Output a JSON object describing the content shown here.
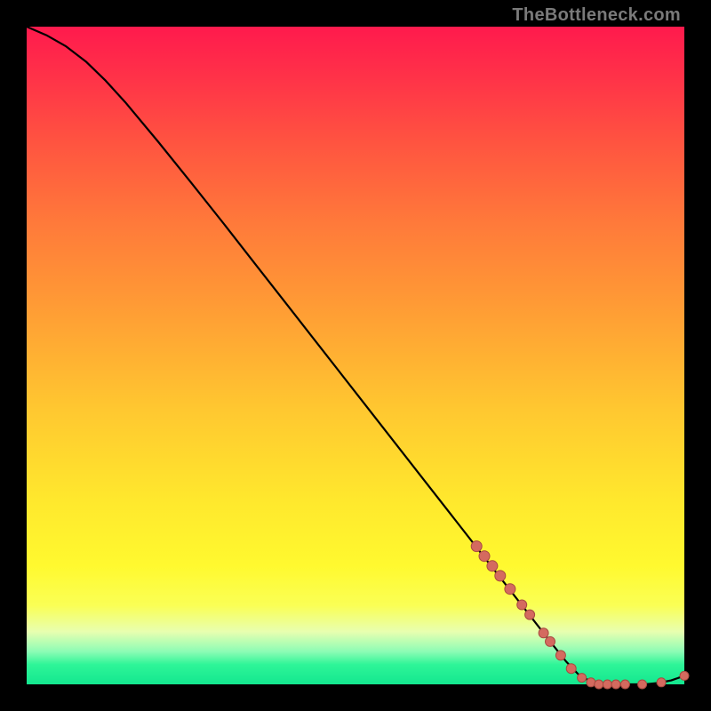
{
  "watermark": "TheBottleneck.com",
  "colors": {
    "gradient_top": "#ff1a4d",
    "gradient_mid": "#ffe82d",
    "gradient_bottom": "#13e78f",
    "curve": "#000000",
    "marker_fill": "#d46a5f",
    "marker_stroke": "#a84a40",
    "background": "#000000"
  },
  "chart_data": {
    "type": "line",
    "title": "",
    "xlabel": "",
    "ylabel": "",
    "xlim": [
      0,
      100
    ],
    "ylim": [
      0,
      100
    ],
    "grid": false,
    "series": [
      {
        "name": "curve",
        "x": [
          0,
          3,
          6,
          9,
          12,
          15,
          20,
          25,
          30,
          35,
          40,
          45,
          50,
          55,
          60,
          65,
          70,
          75,
          80,
          82,
          84,
          86,
          88,
          90,
          92,
          94,
          96,
          98,
          100
        ],
        "y": [
          100,
          98.7,
          97.0,
          94.7,
          91.8,
          88.5,
          82.5,
          76.3,
          70.0,
          63.6,
          57.2,
          50.8,
          44.4,
          38.0,
          31.6,
          25.2,
          18.8,
          12.4,
          6.0,
          3.5,
          1.4,
          0.3,
          0.0,
          0.0,
          0.0,
          0.0,
          0.2,
          0.6,
          1.3
        ]
      }
    ],
    "markers": [
      {
        "x": 68.4,
        "y": 21.0,
        "r": 6
      },
      {
        "x": 69.6,
        "y": 19.5,
        "r": 6
      },
      {
        "x": 70.8,
        "y": 18.0,
        "r": 6
      },
      {
        "x": 72.0,
        "y": 16.5,
        "r": 6
      },
      {
        "x": 73.5,
        "y": 14.5,
        "r": 6
      },
      {
        "x": 75.3,
        "y": 12.1,
        "r": 5.5
      },
      {
        "x": 76.5,
        "y": 10.6,
        "r": 5.5
      },
      {
        "x": 78.6,
        "y": 7.8,
        "r": 5.5
      },
      {
        "x": 79.6,
        "y": 6.5,
        "r": 5.5
      },
      {
        "x": 81.2,
        "y": 4.4,
        "r": 5.5
      },
      {
        "x": 82.8,
        "y": 2.4,
        "r": 5.5
      },
      {
        "x": 84.4,
        "y": 1.0,
        "r": 5
      },
      {
        "x": 85.8,
        "y": 0.3,
        "r": 5
      },
      {
        "x": 87.0,
        "y": 0.0,
        "r": 5
      },
      {
        "x": 88.3,
        "y": 0.0,
        "r": 5
      },
      {
        "x": 89.6,
        "y": 0.0,
        "r": 5
      },
      {
        "x": 91.0,
        "y": 0.0,
        "r": 5
      },
      {
        "x": 93.6,
        "y": 0.0,
        "r": 5
      },
      {
        "x": 96.5,
        "y": 0.3,
        "r": 5
      },
      {
        "x": 100.0,
        "y": 1.3,
        "r": 5
      }
    ]
  }
}
